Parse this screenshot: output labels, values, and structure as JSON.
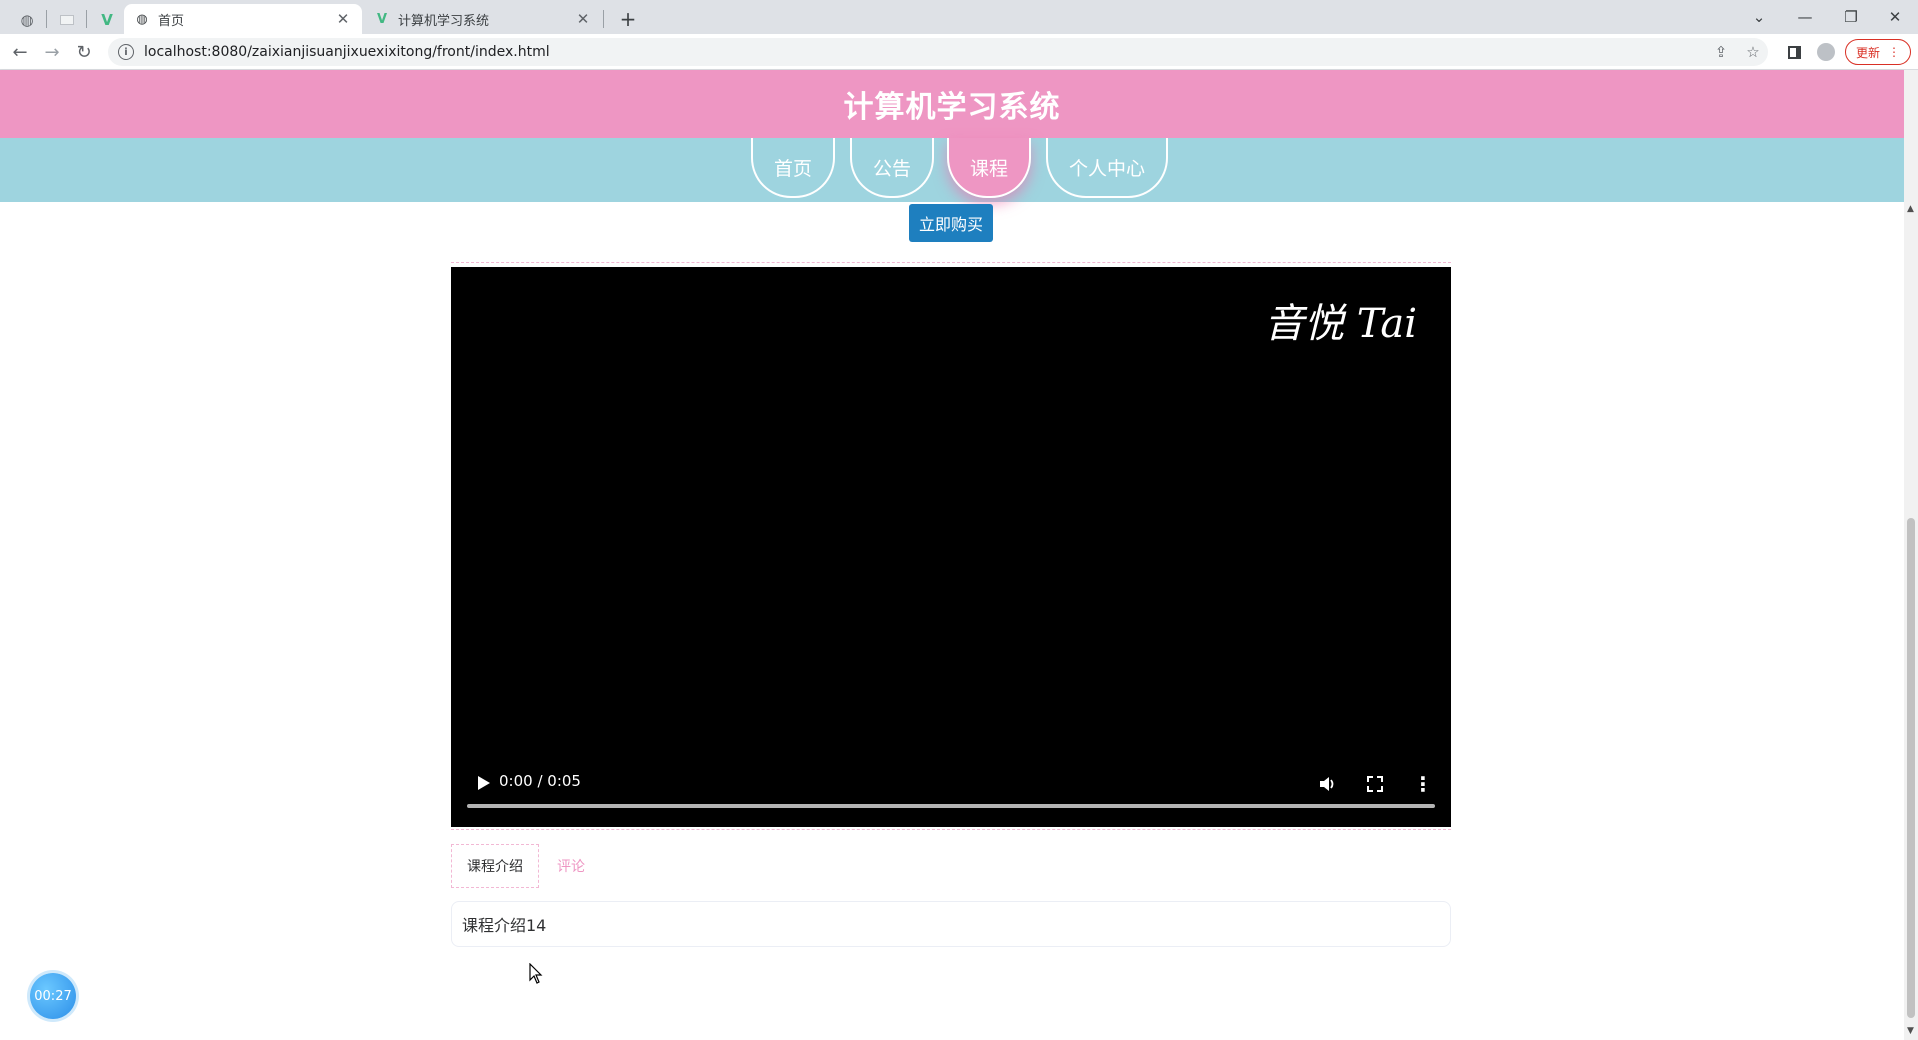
{
  "browser": {
    "tabs": [
      {
        "title": "首页",
        "active": true
      },
      {
        "title": "计算机学习系统",
        "active": false
      }
    ],
    "url": "localhost:8080/zaixianjisuanjixuexixitong/front/index.html",
    "update_label": "更新"
  },
  "site": {
    "title": "计算机学习系统",
    "nav": [
      "首页",
      "公告",
      "课程",
      "个人中心"
    ],
    "active_nav": "课程",
    "buy_label": "立即购买"
  },
  "video": {
    "watermark": "音悦 Tai",
    "time": "0:00 / 0:05",
    "progress": 0
  },
  "course": {
    "tabs": [
      "课程介绍",
      "评论"
    ],
    "active_tab": "课程介绍",
    "intro": "课程介绍14"
  },
  "timer": "00:27"
}
